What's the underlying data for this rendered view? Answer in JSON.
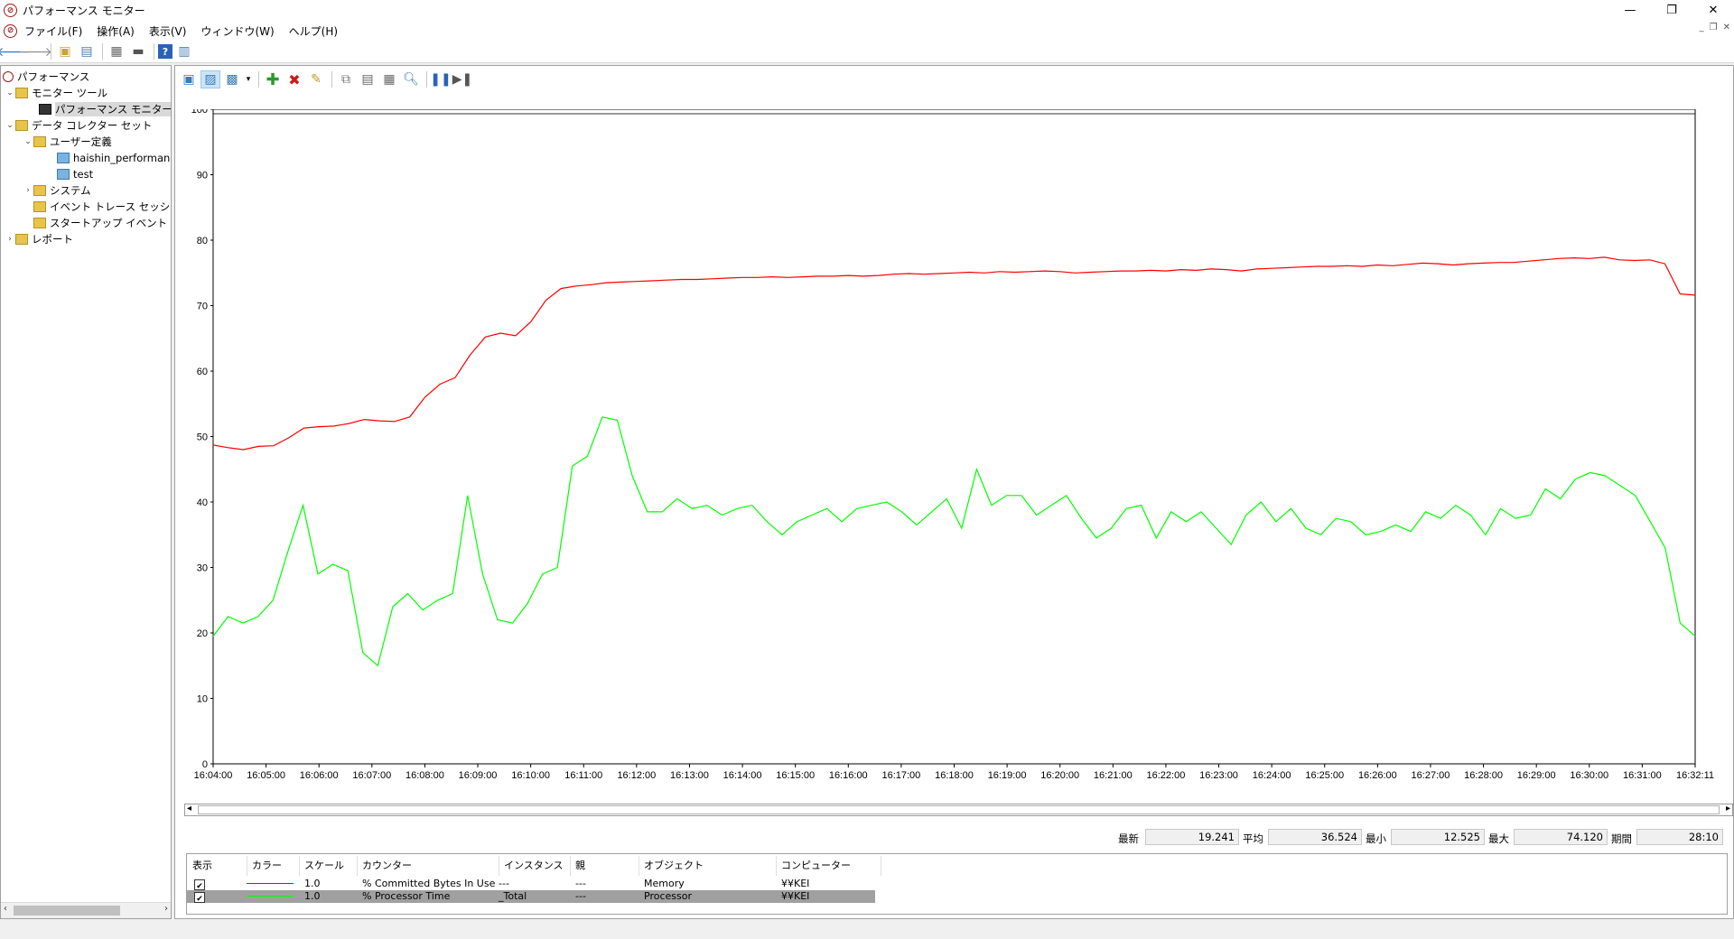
{
  "window": {
    "title": "パフォーマンス モニター",
    "app_icon": "perfmon-icon",
    "controls": [
      "minimize-icon",
      "restore-icon",
      "close-icon"
    ]
  },
  "menu": {
    "items": [
      "ファイル(F)",
      "操作(A)",
      "表示(V)",
      "ウィンドウ(W)",
      "ヘルプ(H)"
    ]
  },
  "sidebar": {
    "items": [
      {
        "label": "パフォーマンス"
      },
      {
        "label": "モニター ツール"
      },
      {
        "label": "パフォーマンス モニター"
      },
      {
        "label": "データ コレクター セット"
      },
      {
        "label": "ユーザー定義"
      },
      {
        "label": "haishin_performanc"
      },
      {
        "label": "test"
      },
      {
        "label": "システム"
      },
      {
        "label": "イベント トレース セッション"
      },
      {
        "label": "スタートアップ イベント トレ"
      },
      {
        "label": "レポート"
      }
    ]
  },
  "stats": {
    "last_label": "最新",
    "last_value": "19.241",
    "avg_label": "平均",
    "avg_value": "36.524",
    "min_label": "最小",
    "min_value": "12.525",
    "max_label": "最大",
    "max_value": "74.120",
    "duration_label": "期間",
    "duration_value": "28:10"
  },
  "legend": {
    "headers": [
      "表示",
      "カラー",
      "スケール",
      "カウンター",
      "インスタンス",
      "親",
      "オブジェクト",
      "コンピューター"
    ],
    "rows": [
      {
        "show": "✔",
        "color": "#ff0000",
        "scale": "1.0",
        "counter": "% Committed Bytes In Use",
        "instance": "---",
        "parent": "---",
        "object": "Memory",
        "computer": "¥¥KEI"
      },
      {
        "show": "✔",
        "color": "#00ff00",
        "scale": "1.0",
        "counter": "% Processor Time",
        "instance": "_Total",
        "parent": "---",
        "object": "Processor",
        "computer": "¥¥KEI"
      }
    ]
  },
  "chart_data": {
    "type": "line",
    "ylim": [
      0,
      100
    ],
    "yticks": [
      "0",
      "10",
      "20",
      "30",
      "40",
      "50",
      "60",
      "70",
      "80",
      "90",
      "100"
    ],
    "xtick_labels": [
      "16:04:00",
      "16:05:00",
      "16:06:00",
      "16:07:00",
      "16:08:00",
      "16:09:00",
      "16:10:00",
      "16:11:00",
      "16:12:00",
      "16:13:00",
      "16:14:00",
      "16:15:00",
      "16:16:00",
      "16:17:00",
      "16:18:00",
      "16:19:00",
      "16:20:00",
      "16:21:00",
      "16:22:00",
      "16:23:00",
      "16:24:00",
      "16:25:00",
      "16:26:00",
      "16:27:00",
      "16:28:00",
      "16:29:00",
      "16:30:00",
      "16:31:00",
      "16:32:11"
    ],
    "series": [
      {
        "color": "#ff0000",
        "points": [
          [
            0,
            48.7
          ],
          [
            1,
            48.3
          ],
          [
            2,
            48.0
          ],
          [
            3,
            48.5
          ],
          [
            4,
            48.6
          ],
          [
            5,
            49.8
          ],
          [
            6,
            51.3
          ],
          [
            7,
            51.5
          ],
          [
            8,
            51.6
          ],
          [
            9,
            52.0
          ],
          [
            10,
            52.6
          ],
          [
            11,
            52.4
          ],
          [
            12,
            52.3
          ],
          [
            13,
            53.0
          ],
          [
            14,
            56.0
          ],
          [
            15,
            58.0
          ],
          [
            16,
            59.0
          ],
          [
            17,
            62.5
          ],
          [
            18,
            65.2
          ],
          [
            19,
            65.8
          ],
          [
            20,
            65.4
          ],
          [
            21,
            67.5
          ],
          [
            22,
            70.8
          ],
          [
            23,
            72.6
          ],
          [
            24,
            73.0
          ],
          [
            25,
            73.2
          ],
          [
            26,
            73.5
          ],
          [
            27,
            73.6
          ],
          [
            28,
            73.7
          ],
          [
            29,
            73.8
          ],
          [
            30,
            73.9
          ],
          [
            31,
            74.0
          ],
          [
            32,
            74.0
          ],
          [
            33,
            74.1
          ],
          [
            34,
            74.2
          ],
          [
            35,
            74.3
          ],
          [
            36,
            74.3
          ],
          [
            37,
            74.4
          ],
          [
            38,
            74.3
          ],
          [
            39,
            74.4
          ],
          [
            40,
            74.5
          ],
          [
            41,
            74.5
          ],
          [
            42,
            74.6
          ],
          [
            43,
            74.5
          ],
          [
            44,
            74.6
          ],
          [
            45,
            74.8
          ],
          [
            46,
            74.9
          ],
          [
            47,
            74.8
          ],
          [
            48,
            74.9
          ],
          [
            49,
            75.0
          ],
          [
            50,
            75.1
          ],
          [
            51,
            75.0
          ],
          [
            52,
            75.2
          ],
          [
            53,
            75.1
          ],
          [
            54,
            75.2
          ],
          [
            55,
            75.3
          ],
          [
            56,
            75.2
          ],
          [
            57,
            75.0
          ],
          [
            58,
            75.1
          ],
          [
            59,
            75.2
          ],
          [
            60,
            75.3
          ],
          [
            61,
            75.3
          ],
          [
            62,
            75.4
          ],
          [
            63,
            75.3
          ],
          [
            64,
            75.5
          ],
          [
            65,
            75.4
          ],
          [
            66,
            75.6
          ],
          [
            67,
            75.5
          ],
          [
            68,
            75.3
          ],
          [
            69,
            75.6
          ],
          [
            70,
            75.7
          ],
          [
            71,
            75.8
          ],
          [
            72,
            75.9
          ],
          [
            73,
            76.0
          ],
          [
            74,
            76.0
          ],
          [
            75,
            76.1
          ],
          [
            76,
            76.0
          ],
          [
            77,
            76.2
          ],
          [
            78,
            76.1
          ],
          [
            79,
            76.3
          ],
          [
            80,
            76.5
          ],
          [
            81,
            76.4
          ],
          [
            82,
            76.2
          ],
          [
            83,
            76.4
          ],
          [
            84,
            76.5
          ],
          [
            85,
            76.6
          ],
          [
            86,
            76.6
          ],
          [
            87,
            76.8
          ],
          [
            88,
            77.0
          ],
          [
            89,
            77.2
          ],
          [
            90,
            77.3
          ],
          [
            91,
            77.2
          ],
          [
            92,
            77.4
          ],
          [
            93,
            77.0
          ],
          [
            94,
            76.9
          ],
          [
            95,
            77.0
          ],
          [
            96,
            76.4
          ],
          [
            97,
            71.8
          ],
          [
            98,
            71.6
          ]
        ]
      },
      {
        "color": "#00ff00",
        "points": [
          [
            0,
            19.5
          ],
          [
            1,
            22.5
          ],
          [
            2,
            21.5
          ],
          [
            3,
            22.5
          ],
          [
            4,
            25.0
          ],
          [
            5,
            32.5
          ],
          [
            6,
            39.5
          ],
          [
            7,
            29.0
          ],
          [
            8,
            30.5
          ],
          [
            9,
            29.5
          ],
          [
            10,
            17.0
          ],
          [
            11,
            15.0
          ],
          [
            12,
            24.0
          ],
          [
            13,
            26.0
          ],
          [
            14,
            23.5
          ],
          [
            15,
            25.0
          ],
          [
            16,
            26.0
          ],
          [
            17,
            41.0
          ],
          [
            18,
            29.0
          ],
          [
            19,
            22.0
          ],
          [
            20,
            21.5
          ],
          [
            21,
            24.5
          ],
          [
            22,
            29.0
          ],
          [
            23,
            30.0
          ],
          [
            24,
            45.5
          ],
          [
            25,
            47.0
          ],
          [
            26,
            53.0
          ],
          [
            27,
            52.5
          ],
          [
            28,
            44.0
          ],
          [
            29,
            38.5
          ],
          [
            30,
            38.5
          ],
          [
            31,
            40.5
          ],
          [
            32,
            39.0
          ],
          [
            33,
            39.5
          ],
          [
            34,
            38.0
          ],
          [
            35,
            39.0
          ],
          [
            36,
            39.5
          ],
          [
            37,
            37.0
          ],
          [
            38,
            35.0
          ],
          [
            39,
            37.0
          ],
          [
            40,
            38.0
          ],
          [
            41,
            39.0
          ],
          [
            42,
            37.0
          ],
          [
            43,
            39.0
          ],
          [
            44,
            39.5
          ],
          [
            45,
            40.0
          ],
          [
            46,
            38.5
          ],
          [
            47,
            36.5
          ],
          [
            48,
            38.5
          ],
          [
            49,
            40.5
          ],
          [
            50,
            36.0
          ],
          [
            51,
            45.0
          ],
          [
            52,
            39.5
          ],
          [
            53,
            41.0
          ],
          [
            54,
            41.0
          ],
          [
            55,
            38.0
          ],
          [
            56,
            39.5
          ],
          [
            57,
            41.0
          ],
          [
            58,
            37.5
          ],
          [
            59,
            34.5
          ],
          [
            60,
            36.0
          ],
          [
            61,
            39.0
          ],
          [
            62,
            39.5
          ],
          [
            63,
            34.5
          ],
          [
            64,
            38.5
          ],
          [
            65,
            37.0
          ],
          [
            66,
            38.5
          ],
          [
            67,
            36.0
          ],
          [
            68,
            33.5
          ],
          [
            69,
            38.0
          ],
          [
            70,
            40.0
          ],
          [
            71,
            37.0
          ],
          [
            72,
            39.0
          ],
          [
            73,
            36.0
          ],
          [
            74,
            35.0
          ],
          [
            75,
            37.5
          ],
          [
            76,
            37.0
          ],
          [
            77,
            35.0
          ],
          [
            78,
            35.5
          ],
          [
            79,
            36.5
          ],
          [
            80,
            35.5
          ],
          [
            81,
            38.5
          ],
          [
            82,
            37.5
          ],
          [
            83,
            39.5
          ],
          [
            84,
            38.0
          ],
          [
            85,
            35.0
          ],
          [
            86,
            39.0
          ],
          [
            87,
            37.5
          ],
          [
            88,
            38.0
          ],
          [
            89,
            42.0
          ],
          [
            90,
            40.5
          ],
          [
            91,
            43.5
          ],
          [
            92,
            44.5
          ],
          [
            93,
            44.0
          ],
          [
            94,
            42.5
          ],
          [
            95,
            41.0
          ],
          [
            96,
            37.0
          ],
          [
            97,
            33.0
          ],
          [
            98,
            21.5
          ],
          [
            99,
            19.5
          ]
        ]
      }
    ]
  }
}
